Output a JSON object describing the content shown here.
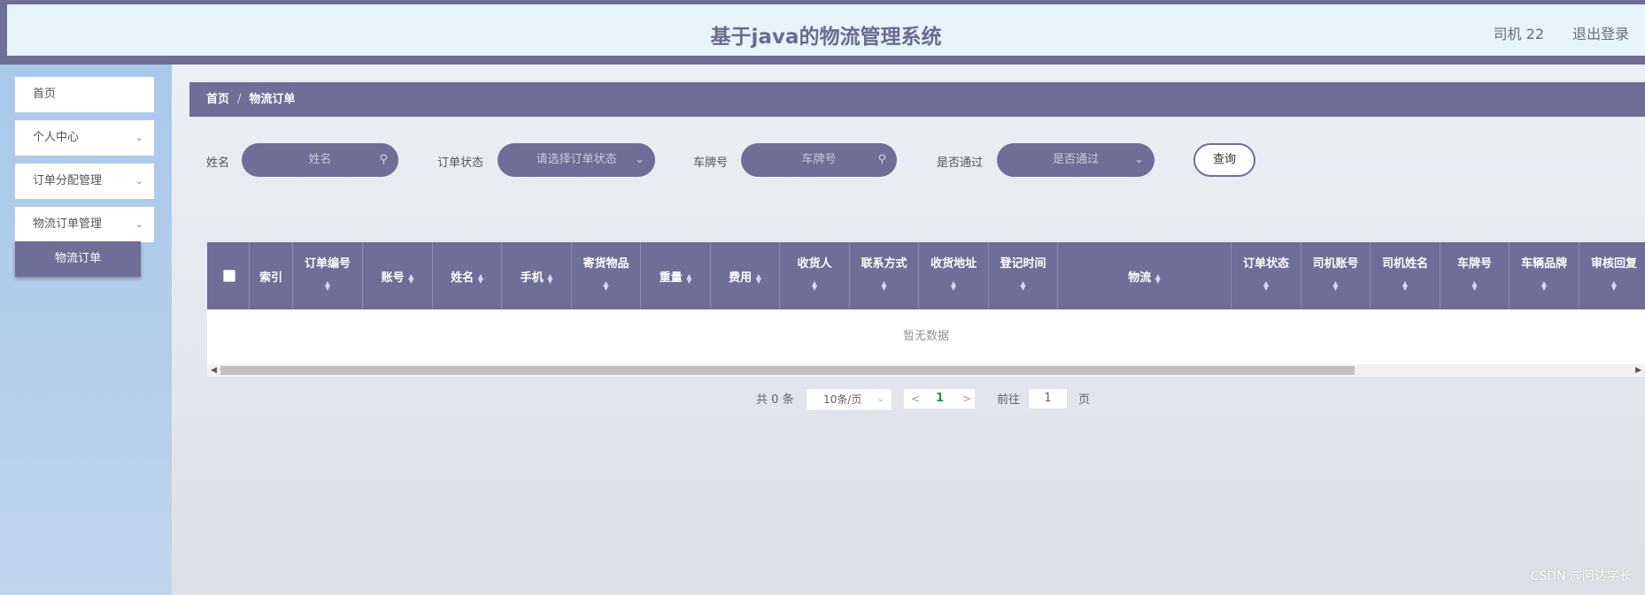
{
  "header": {
    "title": "基于java的物流管理系统",
    "user": "司机 22",
    "logout": "退出登录"
  },
  "sidebar": {
    "items": [
      {
        "label": "首页"
      },
      {
        "label": "个人中心"
      },
      {
        "label": "订单分配管理"
      },
      {
        "label": "物流订单管理"
      }
    ],
    "sub_item": "物流订单"
  },
  "breadcrumb": {
    "home": "首页",
    "separator": "/",
    "current": "物流订单"
  },
  "search": {
    "name_label": "姓名",
    "name_placeholder": "姓名",
    "status_label": "订单状态",
    "status_placeholder": "请选择订单状态",
    "plate_label": "车牌号",
    "plate_placeholder": "车牌号",
    "pass_label": "是否通过",
    "pass_placeholder": "是否通过",
    "query_button": "查询"
  },
  "table": {
    "columns": [
      "索引",
      "订单编号",
      "账号",
      "姓名",
      "手机",
      "寄货物品",
      "重量",
      "费用",
      "收货人",
      "联系方式",
      "收货地址",
      "登记时间",
      "物流",
      "订单状态",
      "司机账号",
      "司机姓名",
      "车牌号",
      "车辆品牌",
      "审核回复"
    ],
    "empty_text": "暂无数据"
  },
  "pagination": {
    "total": "共 0 条",
    "page_size": "10条/页",
    "current_page": "1",
    "goto_label": "前往",
    "goto_value": "1",
    "page_label": "页"
  },
  "watermark": "CSDN @阿达学长",
  "colors": {
    "primary": "#6e6e96",
    "header_bg": "#e8f4fc",
    "sidebar_bg": "#b0cbe9"
  }
}
